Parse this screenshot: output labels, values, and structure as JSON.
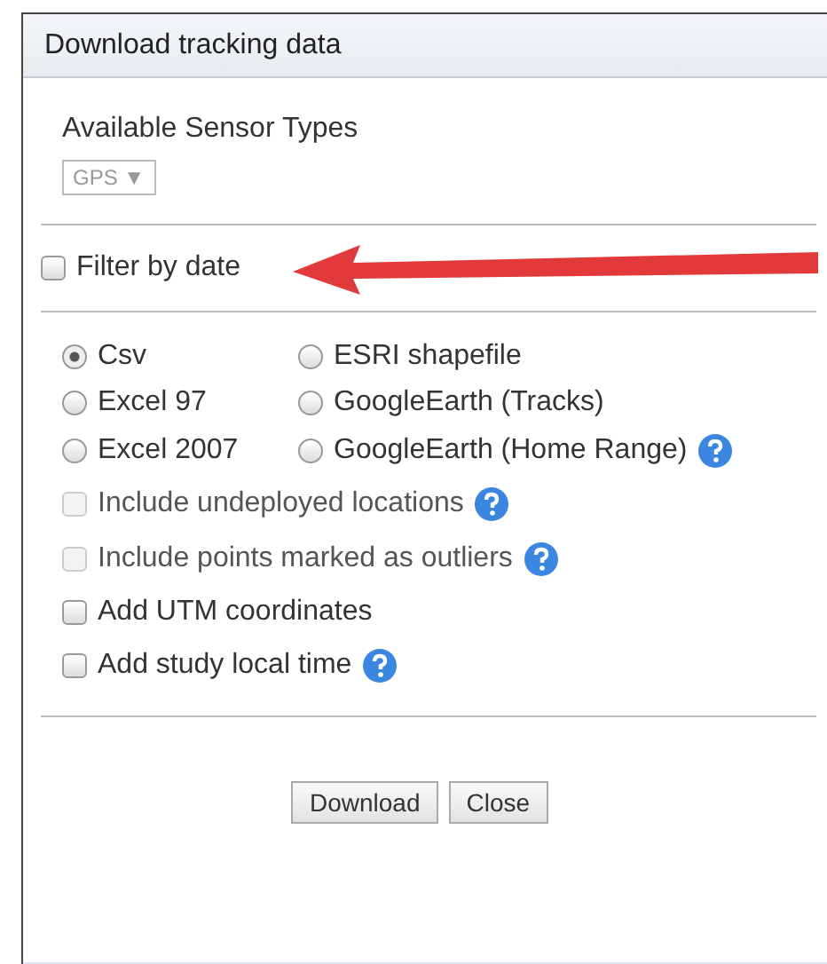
{
  "window": {
    "title": "Download tracking data"
  },
  "sensor": {
    "label": "Available Sensor Types",
    "value": "GPS ▼",
    "disabled": true
  },
  "filter_by_date": {
    "label": "Filter by date",
    "checked": false
  },
  "formats": [
    {
      "label": "Csv",
      "selected": true,
      "help": false
    },
    {
      "label": "ESRI shapefile",
      "selected": false,
      "help": false
    },
    {
      "label": "Excel 97",
      "selected": false,
      "help": false
    },
    {
      "label": "GoogleEarth (Tracks)",
      "selected": false,
      "help": false
    },
    {
      "label": "Excel 2007",
      "selected": false,
      "help": false
    },
    {
      "label": "GoogleEarth (Home Range)",
      "selected": false,
      "help": true
    }
  ],
  "options": [
    {
      "label": "Include undeployed locations",
      "checked": false,
      "disabled": true,
      "help": true
    },
    {
      "label": "Include points marked as outliers",
      "checked": false,
      "disabled": true,
      "help": true
    },
    {
      "label": "Add UTM coordinates",
      "checked": false,
      "disabled": false,
      "help": false
    },
    {
      "label": "Add study local time",
      "checked": false,
      "disabled": false,
      "help": true
    }
  ],
  "buttons": [
    "Download",
    "Close"
  ]
}
